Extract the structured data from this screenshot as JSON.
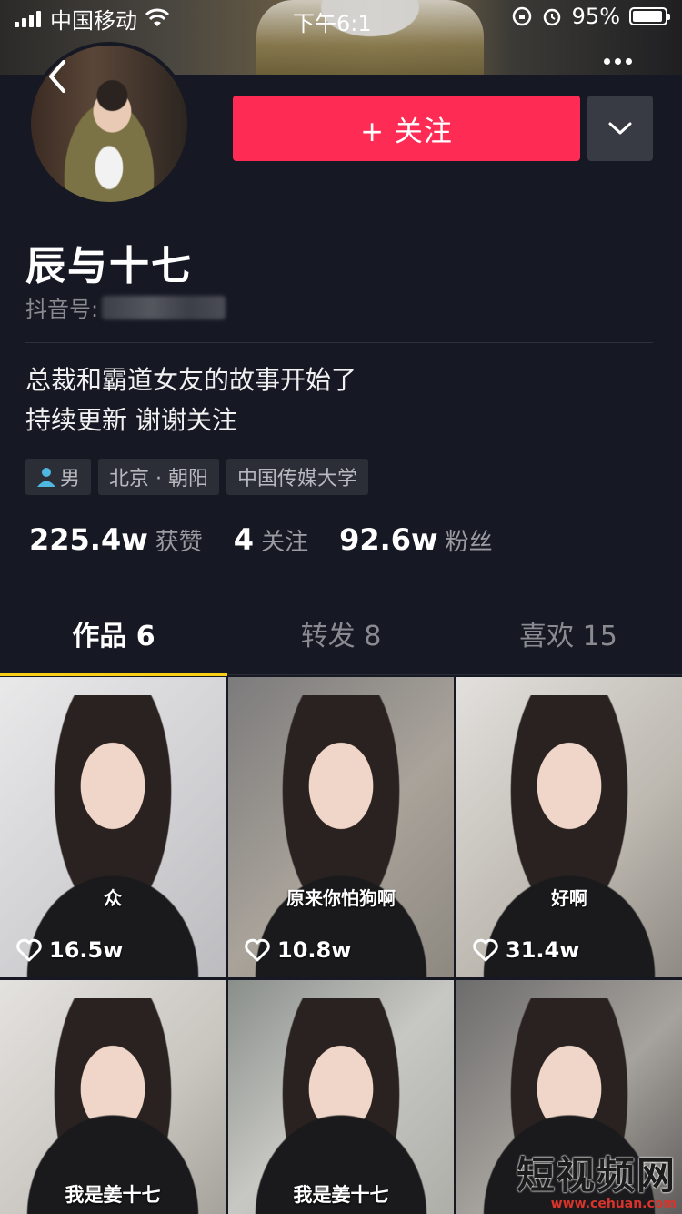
{
  "status_bar": {
    "carrier": "中国移动",
    "time": "下午6:1",
    "battery_text": "95%",
    "battery_level": 0.95
  },
  "profile": {
    "follow_label": "+ 关注",
    "name": "辰与十七",
    "id_label": "抖音号:",
    "bio_line1": "总裁和霸道女友的故事开始了",
    "bio_line2": "持续更新 谢谢关注",
    "tags": [
      "男",
      "北京 · 朝阳",
      "中国传媒大学"
    ]
  },
  "stats": [
    {
      "value": "225.4w",
      "label": "获赞"
    },
    {
      "value": "4",
      "label": "关注"
    },
    {
      "value": "92.6w",
      "label": "粉丝"
    }
  ],
  "tabs": [
    {
      "label": "作品 6"
    },
    {
      "label": "转发 8"
    },
    {
      "label": "喜欢 15"
    }
  ],
  "videos": [
    {
      "caption": "众",
      "likes": "16.5w"
    },
    {
      "caption": "原来你怕狗啊",
      "likes": "10.8w"
    },
    {
      "caption": "好啊",
      "likes": "31.4w"
    },
    {
      "caption": "我是姜十七",
      "likes": ""
    },
    {
      "caption": "我是姜十七",
      "likes": ""
    },
    {
      "caption": "",
      "likes": ""
    }
  ],
  "watermark": {
    "main": "短视频网",
    "sub": "www.cehuan.com"
  },
  "colors": {
    "background": "#161823",
    "follow": "#fe2c55",
    "tab_indicator": "#face15"
  },
  "icons": [
    "back-icon",
    "more-icon",
    "chevron-down-icon",
    "wifi-icon",
    "battery-icon",
    "person-icon",
    "heart-icon"
  ]
}
